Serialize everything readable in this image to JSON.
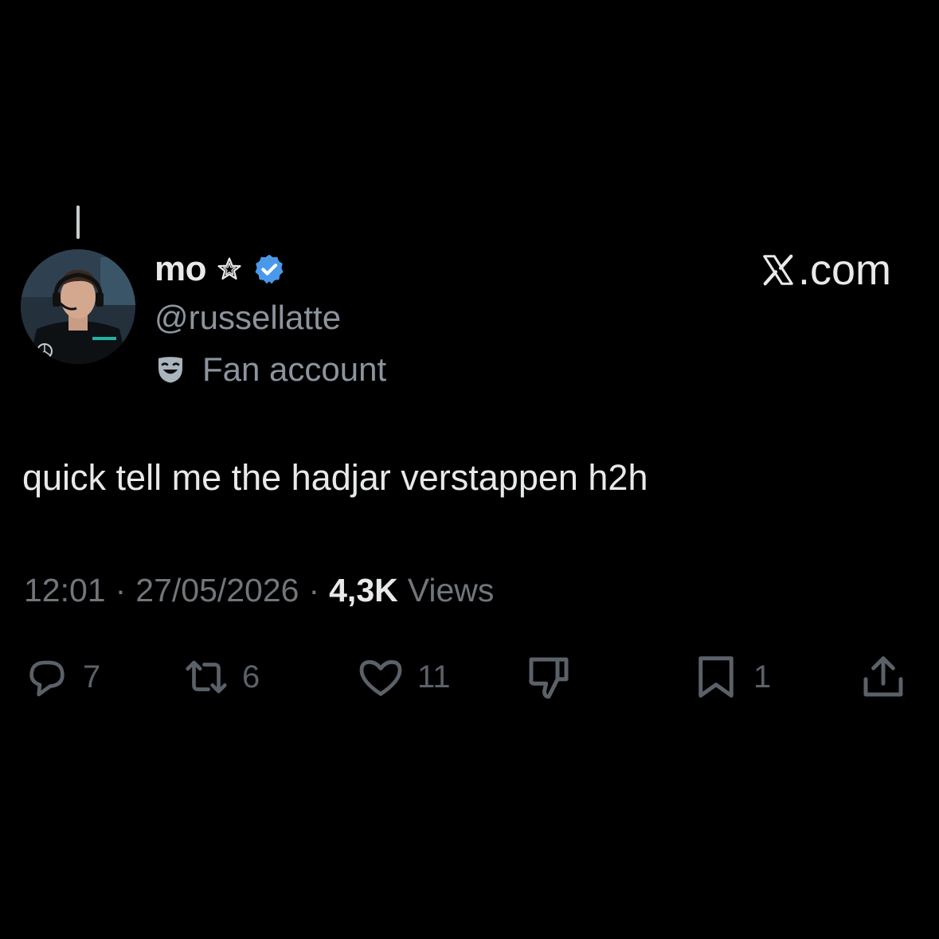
{
  "author": {
    "display_name": "mo",
    "handle": "@russellatte",
    "affiliation_label": "Fan account",
    "name_badge_icon": "star-outline-icon",
    "verified_icon": "verified-badge-icon",
    "verified_color": "#4a99e9"
  },
  "brand": {
    "suffix": ".com",
    "logo_icon": "x-logo-icon"
  },
  "tweet": {
    "text": "quick tell me the hadjar verstappen h2h"
  },
  "meta": {
    "time": "12:01",
    "separator": "·",
    "date": "27/05/2026",
    "views_count": "4,3K",
    "views_label": "Views"
  },
  "actions": {
    "replies": "7",
    "reposts": "6",
    "likes": "11",
    "bookmarks": "1"
  },
  "colors": {
    "background": "#000000",
    "primary_text": "#e7e9ea",
    "secondary_text": "#8b949e",
    "muted_icons": "#5b6168"
  }
}
